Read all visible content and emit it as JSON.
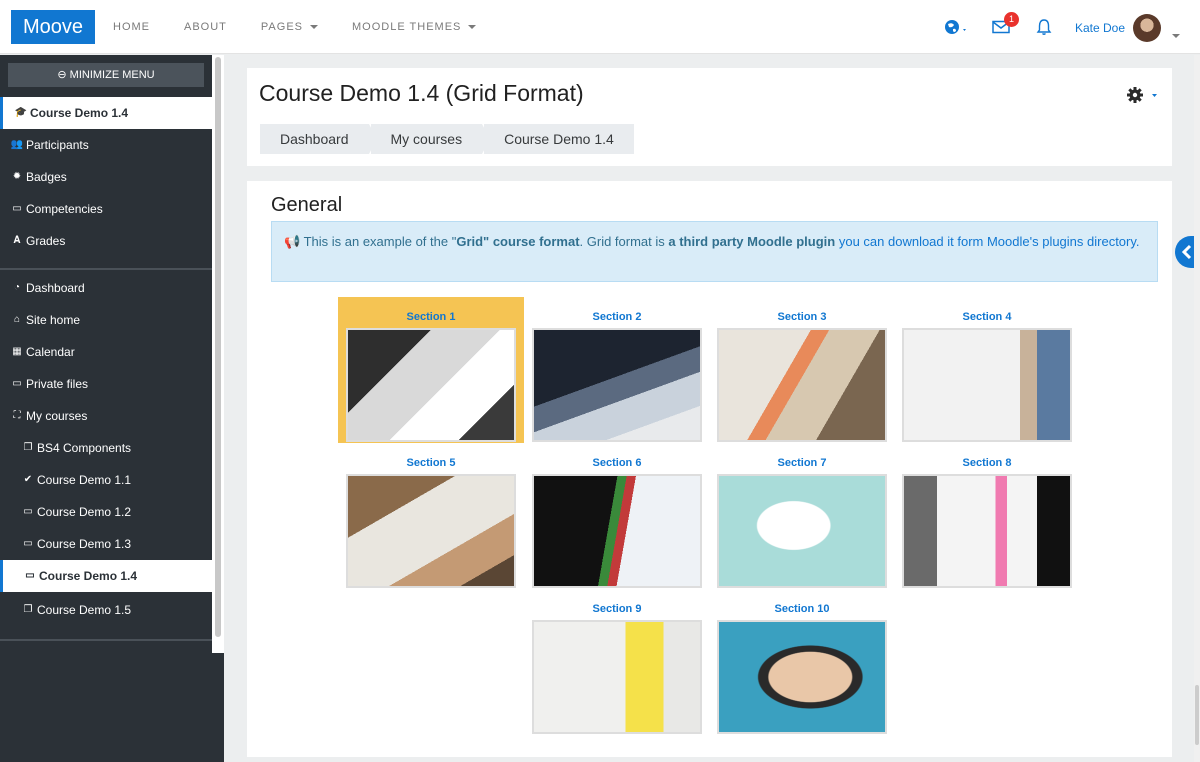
{
  "navbar": {
    "brand": "Moove",
    "links": [
      {
        "label": "HOME"
      },
      {
        "label": "ABOUT"
      },
      {
        "label": "PAGES"
      },
      {
        "label": "MOODLE THEMES"
      }
    ],
    "messages_badge": "1",
    "username": "Kate Doe",
    "colors": {
      "brand": "#1177d1",
      "badge": "#e9322d"
    }
  },
  "sidebar": {
    "minimize_label": "MINIMIZE MENU",
    "course_items": [
      {
        "label": "Course Demo 1.4",
        "icon": "graduation-cap-icon"
      },
      {
        "label": "Participants",
        "icon": "users-icon"
      },
      {
        "label": "Badges",
        "icon": "badge-icon"
      },
      {
        "label": "Competencies",
        "icon": "folder-icon"
      },
      {
        "label": "Grades",
        "icon": "grades-icon"
      }
    ],
    "site_items": [
      {
        "label": "Dashboard",
        "icon": "dashboard-icon"
      },
      {
        "label": "Site home",
        "icon": "home-icon"
      },
      {
        "label": "Calendar",
        "icon": "calendar-icon"
      },
      {
        "label": "Private files",
        "icon": "folder-icon"
      },
      {
        "label": "My courses",
        "icon": "sitemap-icon"
      }
    ],
    "course_list": [
      {
        "label": "BS4 Components",
        "icon": "copy-icon"
      },
      {
        "label": "Course Demo 1.1",
        "icon": "check-circle-icon"
      },
      {
        "label": "Course Demo 1.2",
        "icon": "folder-icon"
      },
      {
        "label": "Course Demo 1.3",
        "icon": "folder-icon"
      },
      {
        "label": "Course Demo 1.4",
        "icon": "folder-icon"
      },
      {
        "label": "Course Demo 1.5",
        "icon": "copy-icon"
      }
    ]
  },
  "header": {
    "title": "Course Demo 1.4 (Grid Format)",
    "breadcrumb": [
      "Dashboard",
      "My courses",
      "Course Demo 1.4"
    ]
  },
  "content": {
    "section_title": "General",
    "alert": {
      "t1": "This is an example of the \"",
      "b1": "Grid\" course format",
      "t2": ". Grid format is ",
      "b2": "a third party Moodle plugin",
      "t3": " you can download it form Moodle's plugins directory."
    },
    "sections": [
      {
        "label": "Section 1",
        "image": "laptop-and-charts-photo"
      },
      {
        "label": "Section 2",
        "image": "coding-laptop-photo"
      },
      {
        "label": "Section 3",
        "image": "design-desk-photo"
      },
      {
        "label": "Section 4",
        "image": "whiteboard-photo"
      },
      {
        "label": "Section 5",
        "image": "notebook-writing-photo"
      },
      {
        "label": "Section 6",
        "image": "stock-market-photo"
      },
      {
        "label": "Section 7",
        "image": "piggy-bank-photo"
      },
      {
        "label": "Section 8",
        "image": "sticky-notes-photo"
      },
      {
        "label": "Section 9",
        "image": "office-photo"
      },
      {
        "label": "Section 10",
        "image": "makeup-portrait-photo"
      }
    ]
  }
}
